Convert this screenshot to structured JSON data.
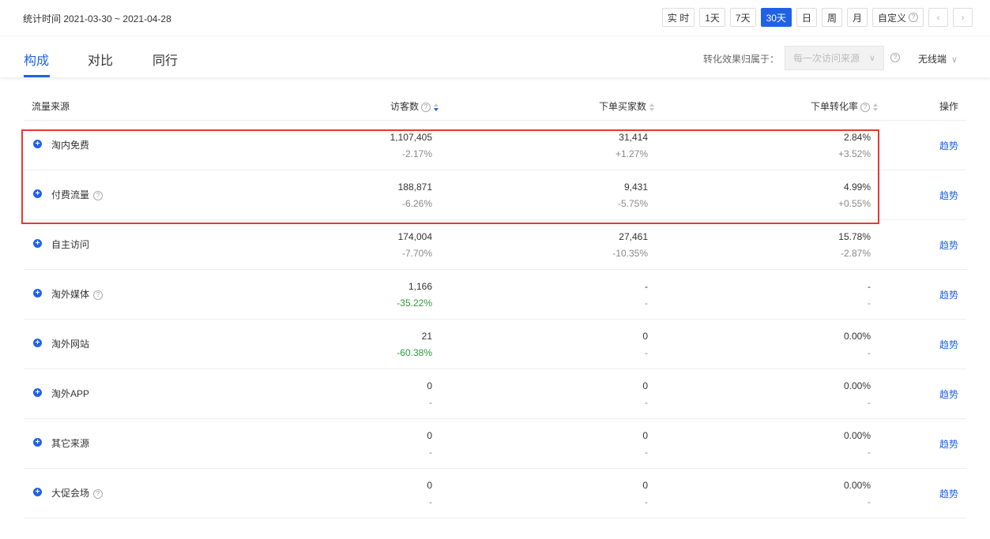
{
  "header": {
    "date_range": "统计时间 2021-03-30 ~ 2021-04-28",
    "range_buttons": [
      "实 时",
      "1天",
      "7天",
      "30天",
      "日",
      "周",
      "月"
    ],
    "custom_label": "自定义",
    "active_range": "30天",
    "prev_icon": "chevron-left-icon",
    "next_icon": "chevron-right-icon"
  },
  "tabs": [
    "构成",
    "对比",
    "同行"
  ],
  "active_tab": "构成",
  "attribution": {
    "label": "转化效果归属于：",
    "value": "每一次访问来源",
    "device": "无线端"
  },
  "table": {
    "headers": {
      "source": "流量来源",
      "visitors": "访客数",
      "buyers": "下单买家数",
      "rate": "下单转化率",
      "action": "操作"
    },
    "rows": [
      {
        "name": "淘内免费",
        "help": false,
        "visitors": "1,107,405",
        "visitors_delta": "-2.17%",
        "buyers": "31,414",
        "buyers_delta": "+1.27%",
        "rate": "2.84%",
        "rate_delta": "+3.52%",
        "action": "趋势"
      },
      {
        "name": "付费流量",
        "help": true,
        "visitors": "188,871",
        "visitors_delta": "-6.26%",
        "buyers": "9,431",
        "buyers_delta": "-5.75%",
        "rate": "4.99%",
        "rate_delta": "+0.55%",
        "action": "趋势"
      },
      {
        "name": "自主访问",
        "help": false,
        "visitors": "174,004",
        "visitors_delta": "-7.70%",
        "buyers": "27,461",
        "buyers_delta": "-10.35%",
        "rate": "15.78%",
        "rate_delta": "-2.87%",
        "action": "趋势"
      },
      {
        "name": "淘外媒体",
        "help": true,
        "visitors": "1,166",
        "visitors_delta": "-35.22%",
        "buyers": "-",
        "buyers_delta": "-",
        "rate": "-",
        "rate_delta": "-",
        "action": "趋势"
      },
      {
        "name": "淘外网站",
        "help": false,
        "visitors": "21",
        "visitors_delta": "-60.38%",
        "buyers": "0",
        "buyers_delta": "-",
        "rate": "0.00%",
        "rate_delta": "-",
        "action": "趋势"
      },
      {
        "name": "淘外APP",
        "help": false,
        "visitors": "0",
        "visitors_delta": "-",
        "buyers": "0",
        "buyers_delta": "-",
        "rate": "0.00%",
        "rate_delta": "-",
        "action": "趋势"
      },
      {
        "name": "其它来源",
        "help": false,
        "visitors": "0",
        "visitors_delta": "-",
        "buyers": "0",
        "buyers_delta": "-",
        "rate": "0.00%",
        "rate_delta": "-",
        "action": "趋势"
      },
      {
        "name": "大促会场",
        "help": true,
        "visitors": "0",
        "visitors_delta": "-",
        "buyers": "0",
        "buyers_delta": "-",
        "rate": "0.00%",
        "rate_delta": "-",
        "action": "趋势"
      }
    ]
  },
  "colors": {
    "accent": "#2062e6",
    "highlight_border": "#e53935",
    "negative_green": "#2c9a3a"
  }
}
